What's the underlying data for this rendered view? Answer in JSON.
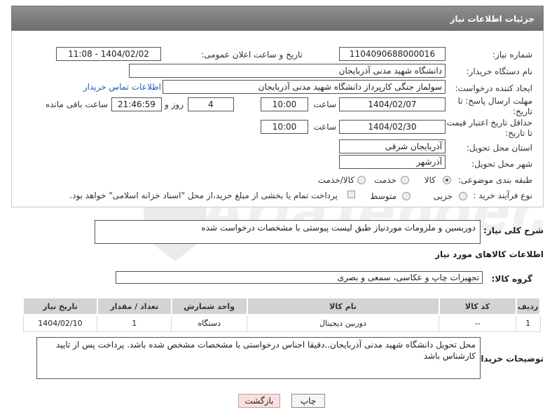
{
  "header": {
    "title": "جزئیات اطلاعات نیاز"
  },
  "fields": {
    "need_number_label": "شماره نیاز:",
    "need_number": "1104090688000016",
    "announce_label": "تاریخ و ساعت اعلان عمومی:",
    "announce_value": "1404/02/02 - 11:08",
    "buyer_org_label": "نام دستگاه خریدار:",
    "buyer_org": "دانشگاه شهید مدنی آذربایجان",
    "creator_label": "ایجاد کننده درخواست:",
    "creator": "سولماز جنگی کارپرداز دانشگاه شهید مدنی آذربایجان",
    "contact_link": "اطلاعات تماس خریدار",
    "reply_deadline_label_1": "مهلت ارسال پاسخ: تا",
    "reply_deadline_label_2": "تاریخ:",
    "reply_date": "1404/02/07",
    "time_label": "ساعت",
    "reply_time": "10:00",
    "days_value": "4",
    "days_label": "روز و",
    "remaining_time": "21:46:59",
    "remaining_label": "ساعت باقی مانده",
    "price_deadline_label_1": "حداقل تاریخ اعتبار قیمت:",
    "price_deadline_label_2": "تا تاریخ:",
    "price_date": "1404/02/30",
    "price_time": "10:00",
    "province_label": "استان محل تحویل:",
    "province": "آذربایجان شرقی",
    "city_label": "شهر محل تحویل:",
    "city": "آذرشهر",
    "category_label": "طبقه بندی موضوعی:",
    "category_options": [
      "کالا",
      "خدمت",
      "کالا/خدمت"
    ],
    "process_label": "نوع فرآیند خرید :",
    "process_options": [
      "جزیی",
      "متوسط"
    ],
    "payment_note": "پرداخت تمام یا بخشی از مبلغ خرید،از محل \"اسناد خزانه اسلامی\" خواهد بود."
  },
  "description": {
    "label": "شرح کلی نیاز:",
    "value": "دوربسین و ملزومات موردنیاز طبق لیست پیوستی با مشخصات درخواست شده"
  },
  "goods_section": {
    "title": "اطلاعات کالاهای مورد نیاز",
    "group_label": "گروه کالا:",
    "group_value": "تجهیزات چاپ و عکاسی، سمعی و بصری"
  },
  "table": {
    "headers": [
      "ردیف",
      "کد کالا",
      "نام کالا",
      "واحد شمارش",
      "تعداد / مقدار",
      "تاریخ نیاز"
    ],
    "rows": [
      [
        "1",
        "--",
        "دوربین دیجیتال",
        "دستگاه",
        "1",
        "1404/02/10"
      ]
    ]
  },
  "buyer_notes": {
    "label": "توضیحات خریدار:",
    "value": "محل تحویل دانشگاه شهید مدنی آذربایجان..دقیقا اجناس درخواستی با مشخصات مشخص شده باشد. پرداخت پس از تایید کارشناس باشد"
  },
  "buttons": {
    "print": "چاپ",
    "back": "بازگشت"
  },
  "watermark": {
    "text": "AriaTender.net"
  }
}
